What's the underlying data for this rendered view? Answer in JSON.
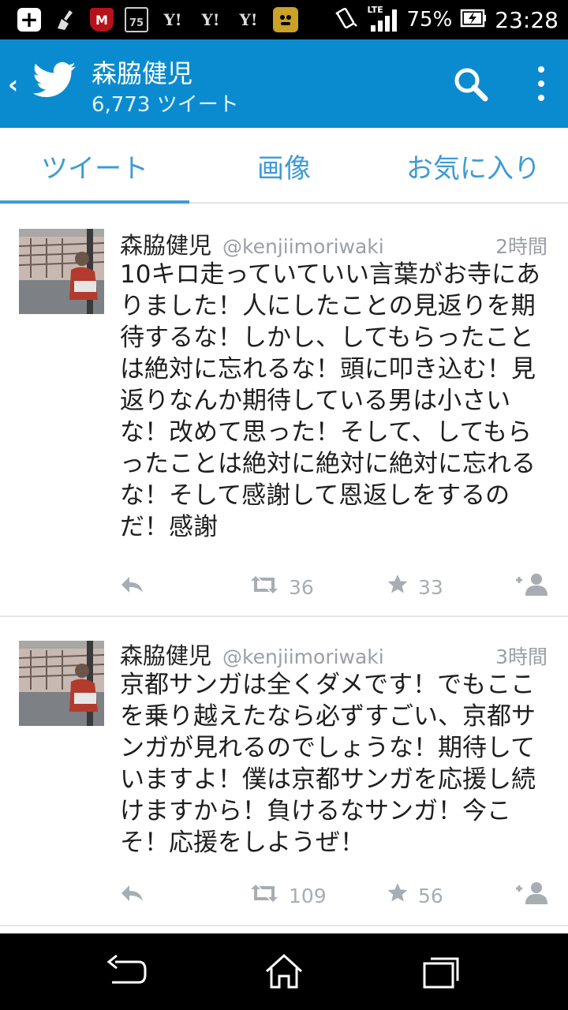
{
  "status_bar": {
    "battery": "75%",
    "time": "23:28",
    "network": "LTE",
    "icons": [
      "add-icon",
      "broom-icon",
      "mcafee-icon",
      "calendar-icon",
      "yahoo-icon",
      "yahoo-icon",
      "yahoo-icon",
      "app-icon",
      "vibrate-icon",
      "signal-icon",
      "battery-icon"
    ],
    "calendar_day": "75",
    "yahoo_label": "Y!",
    "mcafee_label": "M"
  },
  "header": {
    "title": "森脇健児",
    "subtitle": "6,773 ツイート"
  },
  "tabs": [
    {
      "label": "ツイート",
      "active": true
    },
    {
      "label": "画像",
      "active": false
    },
    {
      "label": "お気に入り",
      "active": false
    }
  ],
  "tweets": [
    {
      "name": "森脇健児",
      "handle": "@kenjiimoriwaki",
      "time": "2時間",
      "text": "10キロ走っていていい言葉がお寺にありました！人にしたことの見返りを期待するな！しかし、してもらったことは絶対に忘れるな！頭に叩き込む！見返りなんか期待している男は小さいな！改めて思った！そして、してもらったことは絶対に絶対に絶対に忘れるな！そして感謝して恩返しをするのだ！感謝",
      "retweets": "36",
      "favorites": "33"
    },
    {
      "name": "森脇健児",
      "handle": "@kenjiimoriwaki",
      "time": "3時間",
      "text": "京都サンガは全くダメです！でもここを乗り越えたなら必ずすごい、京都サンガが見れるのでしょうな！期待していますよ！僕は京都サンガを応援し続けますから！負けるなサンガ！今こそ！応援をしようぜ！",
      "retweets": "109",
      "favorites": "56"
    }
  ],
  "colors": {
    "accent": "#0b8bcf",
    "tab_text": "#3d9bd6"
  }
}
